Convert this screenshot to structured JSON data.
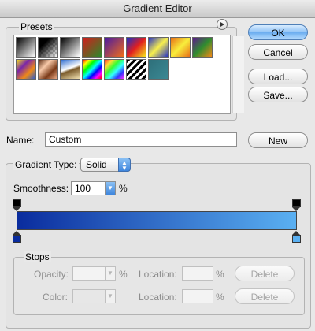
{
  "window": {
    "title": "Gradient Editor"
  },
  "presets": {
    "label": "Presets",
    "menu_icon": "triangle-right-circle-icon",
    "swatches": [
      {
        "name": "preset-fg-bg",
        "bg": "linear-gradient(135deg,#000,#fff)"
      },
      {
        "name": "preset-fg-transparent",
        "bg": "linear-gradient(135deg,#000 30%,transparent 100%), repeating-conic-gradient(#ccc 0 25%,#fff 0 50%) 0 0/6px 6px"
      },
      {
        "name": "preset-black-white",
        "bg": "linear-gradient(135deg,#000,#fff)"
      },
      {
        "name": "preset-red-green",
        "bg": "linear-gradient(135deg,#d21d1d,#2a8a2a)"
      },
      {
        "name": "preset-violet-orange",
        "bg": "linear-gradient(135deg,#4b1aa0,#f06d1a)"
      },
      {
        "name": "preset-blue-red-yellow",
        "bg": "linear-gradient(135deg,#1b2fc4,#e11f1f,#f6e51b)"
      },
      {
        "name": "preset-blue-yellow-blue",
        "bg": "linear-gradient(135deg,#2a35c2,#f8f04d,#2a35c2)"
      },
      {
        "name": "preset-orange-yellow-orange",
        "bg": "linear-gradient(135deg,#e86f16,#f8ee3c,#e86f16)"
      },
      {
        "name": "preset-violet-green-orange",
        "bg": "linear-gradient(135deg,#5b1b8a,#2f8c2f,#f08a16)"
      },
      {
        "name": "preset-yellow-violet-orange-blue",
        "bg": "linear-gradient(135deg,#f4e31b,#7a26a8,#f08a16,#2a5cd0)"
      },
      {
        "name": "preset-copper",
        "bg": "linear-gradient(135deg,#5a2a12,#f7c9a8,#7a3a18,#f0b08a)"
      },
      {
        "name": "preset-chrome",
        "bg": "linear-gradient(160deg,#2b6ad0,#fff 45%,#7a5a2a 55%,#f0e0b0)"
      },
      {
        "name": "preset-spectrum",
        "bg": "linear-gradient(135deg,#f00,#ff0,#0f0,#0ff,#00f,#f0f,#f00)"
      },
      {
        "name": "preset-transparent-rainbow",
        "bg": "linear-gradient(135deg,#f33,#fd3,#3f3,#3ff,#33f,#f3f)"
      },
      {
        "name": "preset-transparent-stripes",
        "bg": "repeating-linear-gradient(135deg,#000 0 3px,#fff 3px 6px)"
      },
      {
        "name": "preset-teal",
        "bg": "linear-gradient(135deg,#2e6f7a,#3b8893)"
      }
    ]
  },
  "buttons": {
    "ok": "OK",
    "cancel": "Cancel",
    "load": "Load...",
    "save": "Save...",
    "new": "New"
  },
  "name_field": {
    "label": "Name:",
    "value": "Custom"
  },
  "gradient_type": {
    "label": "Gradient Type:",
    "selected": "Solid"
  },
  "smoothness": {
    "label": "Smoothness:",
    "value": "100",
    "unit": "%"
  },
  "gradient": {
    "colors": [
      "#0a2c9e",
      "#5ab0f2"
    ],
    "start_color": "#0a2c9e",
    "end_color": "#5ab0f2"
  },
  "stops": {
    "label": "Stops",
    "opacity_label": "Opacity:",
    "opacity_value": "",
    "opacity_unit": "%",
    "color_label": "Color:",
    "location_label": "Location:",
    "location_value": "",
    "location_unit": "%",
    "delete": "Delete"
  }
}
